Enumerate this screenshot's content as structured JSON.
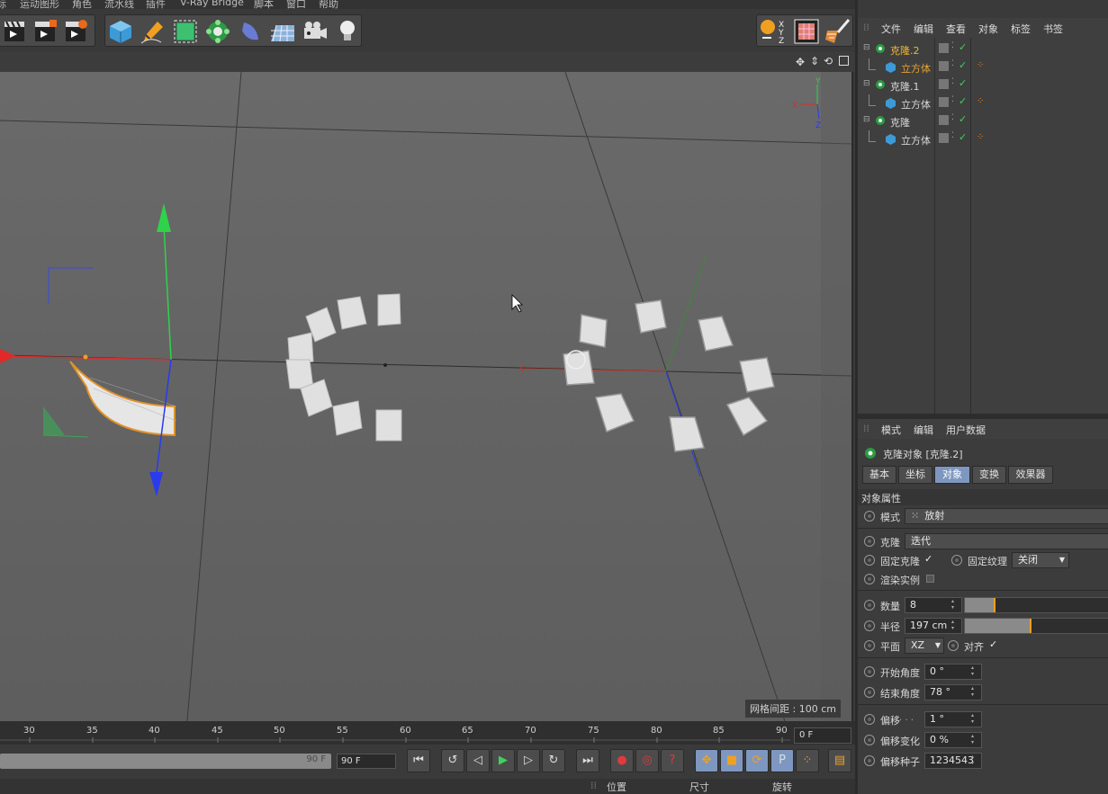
{
  "menu": [
    "标",
    "运动图形",
    "角色",
    "流水线",
    "插件",
    "V-Ray Bridge",
    "脚本",
    "窗口",
    "帮助"
  ],
  "toolbar": {
    "icons": [
      "clapper-render-icon",
      "clapper-play-icon",
      "clapper-settings-icon",
      "cube-icon",
      "pen-icon",
      "subdivision-icon",
      "cloner-flower-icon",
      "deformer-icon",
      "floor-icon",
      "camera-icon",
      "light-bulb-icon"
    ],
    "right_icons": [
      "xyz-axis-icon",
      "texture-icon",
      "paint-icon"
    ]
  },
  "viewport": {
    "grid_spacing": "网格间距 : 100 cm",
    "axis_labels": {
      "x": "X",
      "y": "Y",
      "z": "Z"
    }
  },
  "timeline": {
    "ticks": [
      "30",
      "35",
      "40",
      "45",
      "50",
      "55",
      "60",
      "65",
      "70",
      "75",
      "80",
      "85",
      "90"
    ],
    "current_frame": "0 F",
    "range_end": "90 F",
    "end_frame": "90 F"
  },
  "coords": {
    "position": "位置",
    "size": "尺寸",
    "rotation": "旋转"
  },
  "object_manager": {
    "menu": [
      "文件",
      "编辑",
      "查看",
      "对象",
      "标签",
      "书签"
    ],
    "objects": [
      {
        "name": "克隆.2",
        "color": "#f2b632",
        "child": false
      },
      {
        "name": "立方体",
        "color": "#e6a23a",
        "child": true
      },
      {
        "name": "克隆.1",
        "color": "#d8d8d8",
        "child": false
      },
      {
        "name": "立方体",
        "color": "#d8d8d8",
        "child": true
      },
      {
        "name": "克隆",
        "color": "#d8d8d8",
        "child": false
      },
      {
        "name": "立方体",
        "color": "#d8d8d8",
        "child": true
      }
    ]
  },
  "attributes": {
    "menu": [
      "模式",
      "编辑",
      "用户数据"
    ],
    "title": "克隆对象 [克隆.2]",
    "tabs": [
      "基本",
      "坐标",
      "对象",
      "变换",
      "效果器"
    ],
    "active_tab": "对象",
    "section": "对象属性",
    "mode_label": "模式",
    "mode_value": "放射",
    "clone_label": "克隆",
    "clone_value": "迭代",
    "fix_clone_label": "固定克隆",
    "fix_clone_checked": "✓",
    "fix_texture_label": "固定纹理",
    "fix_texture_value": "关闭",
    "render_instances_label": "渲染实例",
    "count_label": "数量",
    "count_value": "8",
    "count_fraction": 0.2,
    "radius_label": "半径",
    "radius_value": "197 cm",
    "radius_fraction": 0.45,
    "plane_label": "平面",
    "plane_value": "XZ",
    "align_label": "对齐",
    "align_checked": "✓",
    "start_angle_label": "开始角度",
    "start_angle_value": "0 °",
    "end_angle_label": "结束角度",
    "end_angle_value": "78 °",
    "offset_label": "偏移",
    "offset_dots": ". . .",
    "offset_value": "1 °",
    "offset_var_label": "偏移变化",
    "offset_var_value": "0 %",
    "offset_seed_label": "偏移种子",
    "offset_seed_value": "1234543"
  },
  "colors": {
    "accent_orange": "#f2a020",
    "tab_active": "#7e97c0",
    "axis_green": "#2fd24a",
    "axis_red": "#e02a2a",
    "axis_blue": "#2a3aef"
  }
}
